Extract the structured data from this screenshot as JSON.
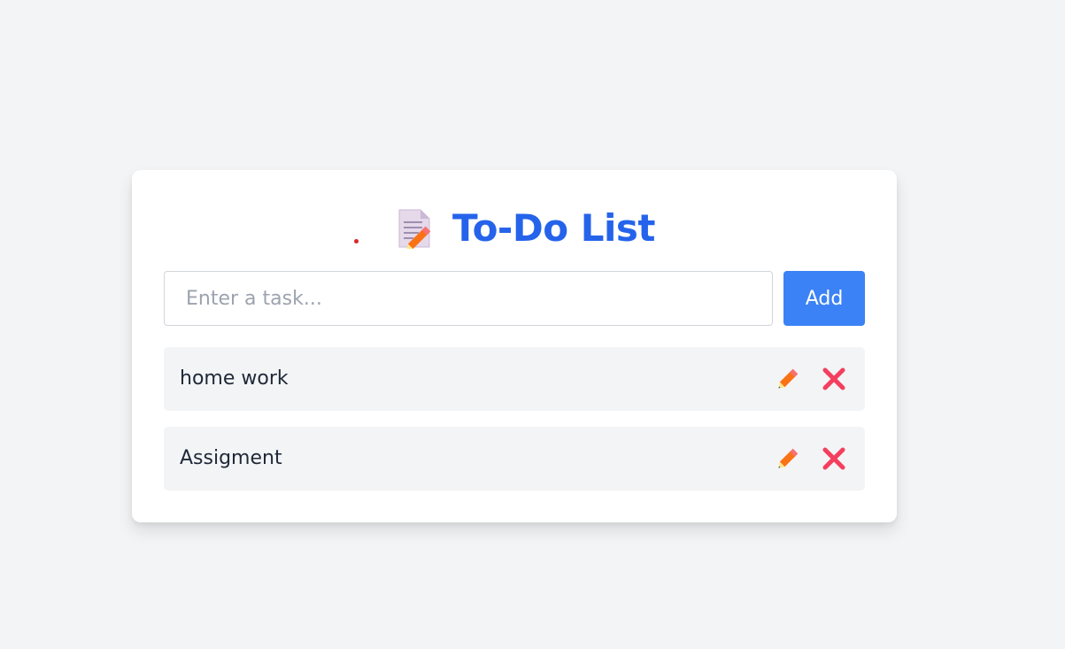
{
  "app": {
    "title": "To-Do List",
    "accent_color": "#2563eb",
    "button_color": "#3b82f6"
  },
  "header": {
    "icon": "memo-icon",
    "title": "To-Do List"
  },
  "form": {
    "input_value": "",
    "input_placeholder": "Enter a task...",
    "add_label": "Add"
  },
  "tasks": [
    {
      "text": "home work",
      "edit_icon": "pencil-icon",
      "delete_icon": "cross-icon"
    },
    {
      "text": "Assigment",
      "edit_icon": "pencil-icon",
      "delete_icon": "cross-icon"
    }
  ]
}
